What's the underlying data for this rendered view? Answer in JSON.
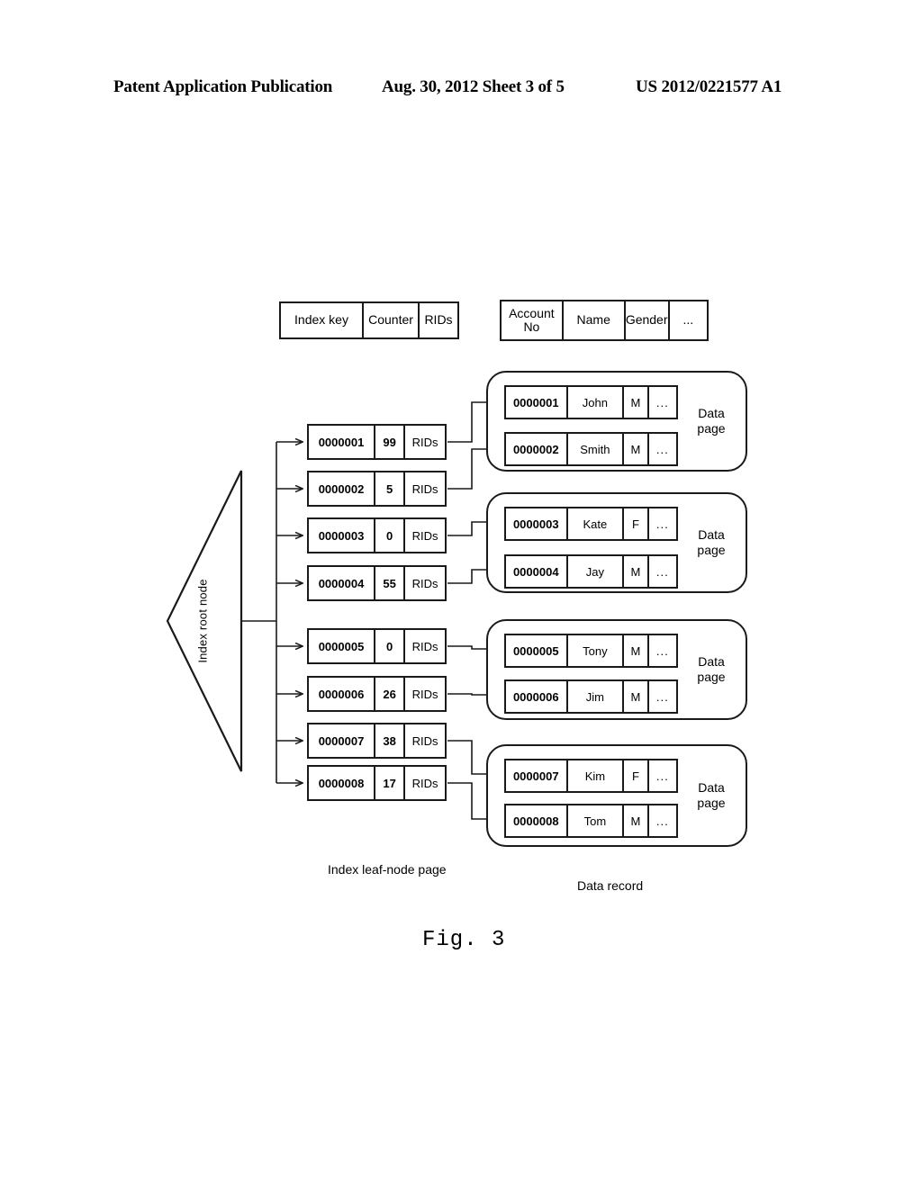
{
  "header": {
    "left": "Patent Application Publication",
    "middle": "Aug. 30, 2012  Sheet 3 of 5",
    "right": "US 2012/0221577 A1"
  },
  "figure": {
    "number": "Fig. 3",
    "captions": {
      "leaf_page": "Index leaf-node page",
      "data_record": "Data record"
    },
    "root_node": {
      "label": "Index root node"
    },
    "index_schema": {
      "columns": [
        "Index key",
        "Counter",
        "RIDs"
      ]
    },
    "record_schema": {
      "columns": [
        "Account No",
        "Name",
        "Gender",
        "..."
      ]
    },
    "index_rows": [
      {
        "key": "0000001",
        "counter": "99",
        "rids": "RIDs"
      },
      {
        "key": "0000002",
        "counter": "5",
        "rids": "RIDs"
      },
      {
        "key": "0000003",
        "counter": "0",
        "rids": "RIDs"
      },
      {
        "key": "0000004",
        "counter": "55",
        "rids": "RIDs"
      },
      {
        "key": "0000005",
        "counter": "0",
        "rids": "RIDs"
      },
      {
        "key": "0000006",
        "counter": "26",
        "rids": "RIDs"
      },
      {
        "key": "0000007",
        "counter": "38",
        "rids": "RIDs"
      },
      {
        "key": "0000008",
        "counter": "17",
        "rids": "RIDs"
      }
    ],
    "data_pages": [
      {
        "label": "Data page",
        "records": [
          {
            "account_no": "0000001",
            "name": "John",
            "gender": "M",
            "more": "..."
          },
          {
            "account_no": "0000002",
            "name": "Smith",
            "gender": "M",
            "more": "..."
          }
        ]
      },
      {
        "label": "Data page",
        "records": [
          {
            "account_no": "0000003",
            "name": "Kate",
            "gender": "F",
            "more": "..."
          },
          {
            "account_no": "0000004",
            "name": "Jay",
            "gender": "M",
            "more": "..."
          }
        ]
      },
      {
        "label": "Data page",
        "records": [
          {
            "account_no": "0000005",
            "name": "Tony",
            "gender": "M",
            "more": "..."
          },
          {
            "account_no": "0000006",
            "name": "Jim",
            "gender": "M",
            "more": "..."
          }
        ]
      },
      {
        "label": "Data page",
        "records": [
          {
            "account_no": "0000007",
            "name": "Kim",
            "gender": "F",
            "more": "..."
          },
          {
            "account_no": "0000008",
            "name": "Tom",
            "gender": "M",
            "more": "..."
          }
        ]
      }
    ]
  },
  "colors": {
    "ink": "#1a1a1a",
    "paper": "#ffffff"
  }
}
